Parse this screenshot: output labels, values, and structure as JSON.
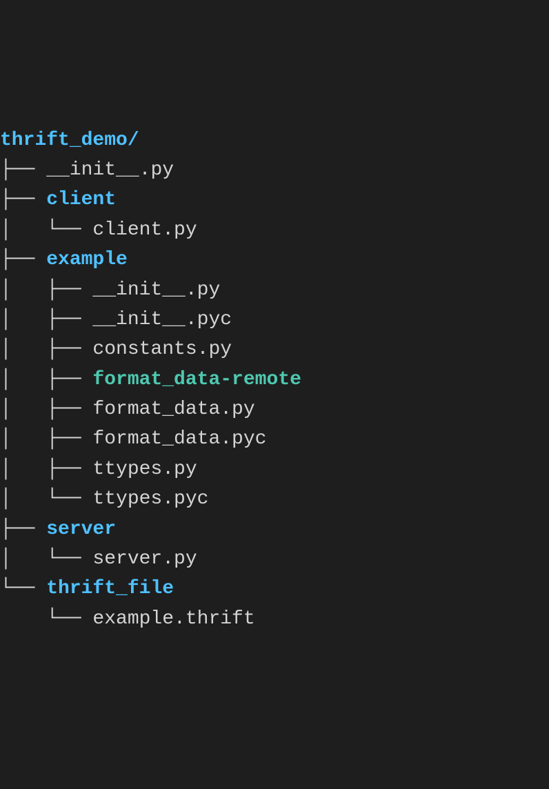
{
  "tree": {
    "root": "thrift_demo/",
    "lines": [
      {
        "branch": "├── ",
        "name": "__init__.py",
        "type": "file"
      },
      {
        "branch": "├── ",
        "name": "client",
        "type": "dir"
      },
      {
        "branch": "│   └── ",
        "name": "client.py",
        "type": "file"
      },
      {
        "branch": "├── ",
        "name": "example",
        "type": "dir"
      },
      {
        "branch": "│   ├── ",
        "name": "__init__.py",
        "type": "file"
      },
      {
        "branch": "│   ├── ",
        "name": "__init__.pyc",
        "type": "file"
      },
      {
        "branch": "│   ├── ",
        "name": "constants.py",
        "type": "file"
      },
      {
        "branch": "│   ├── ",
        "name": "format_data-remote",
        "type": "exec"
      },
      {
        "branch": "│   ├── ",
        "name": "format_data.py",
        "type": "file"
      },
      {
        "branch": "│   ├── ",
        "name": "format_data.pyc",
        "type": "file"
      },
      {
        "branch": "│   ├── ",
        "name": "ttypes.py",
        "type": "file"
      },
      {
        "branch": "│   └── ",
        "name": "ttypes.pyc",
        "type": "file"
      },
      {
        "branch": "├── ",
        "name": "server",
        "type": "dir"
      },
      {
        "branch": "│   └── ",
        "name": "server.py",
        "type": "file"
      },
      {
        "branch": "└── ",
        "name": "thrift_file",
        "type": "dir"
      },
      {
        "branch": "    └── ",
        "name": "example.thrift",
        "type": "file"
      }
    ]
  }
}
